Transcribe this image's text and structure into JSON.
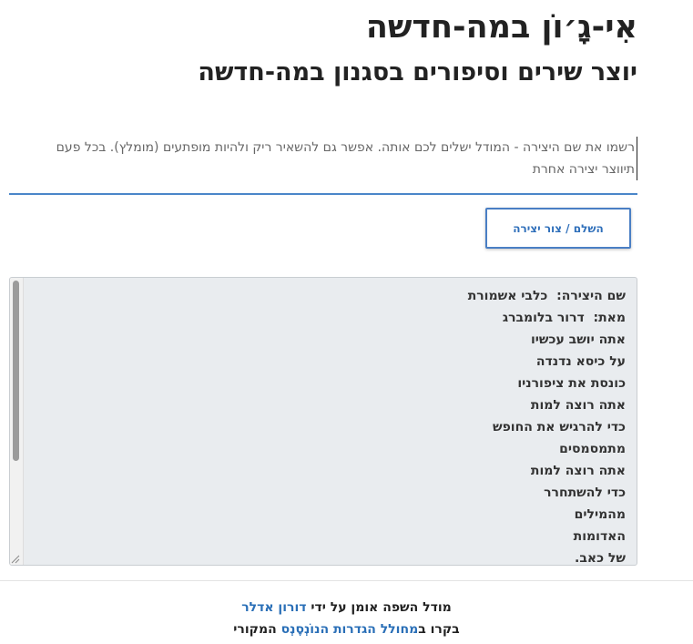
{
  "header": {
    "title": "אִי-גָ׳וֹן במה-חדשה",
    "subtitle": "יוצר שירים וסיפורים בסגנון במה-חדשה"
  },
  "prompt": {
    "line1": "רשמו את שם היצירה - המודל ישלים לכם אותה. אפשר גם להשאיר ריק ולהיות מופתעים (מומלץ). בכל פעם",
    "line2": "תיווצר יצירה אחרת"
  },
  "generate_button": {
    "label": "השלם / צור יצירה"
  },
  "output": {
    "lines": [
      "שם היצירה:  כלבי אשמורת",
      "מאת:  דרור בלומברג",
      "אתה יושב עכשיו",
      "על כיסא נדנדה",
      "כונסת את ציפורניו",
      "אתה רוצה למות",
      "כדי להרגיש את החופש",
      "מתמסמסים",
      "אתה רוצה למות",
      "כדי להשתחרר",
      "מהמילים",
      "האדומות",
      "של כאב."
    ]
  },
  "footer": {
    "line1_prefix": "מודל השפה אומן על ידי",
    "line1_link": "דורון אדלר",
    "line2_prefix": "בקרו ב",
    "line2_link": "מחולל הגדרות הנוֹנְסֶנְס",
    "line2_suffix": "המקורי"
  }
}
